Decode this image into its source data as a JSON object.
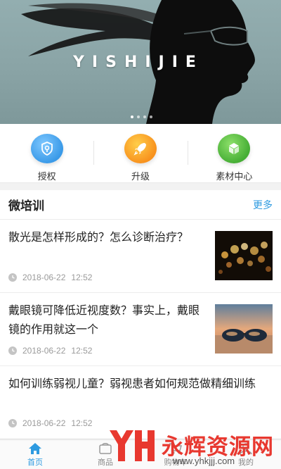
{
  "banner": {
    "text": "YISHIJIE",
    "slide_count": 4,
    "active_slide": 1
  },
  "quick_actions": [
    {
      "label": "授权",
      "icon": "shield-key-icon",
      "color": "#3a9ae8"
    },
    {
      "label": "升级",
      "icon": "rocket-icon",
      "color": "#f8921e"
    },
    {
      "label": "素材中心",
      "icon": "cube-icon",
      "color": "#46ae35"
    }
  ],
  "section": {
    "title": "微培训",
    "more": "更多",
    "articles": [
      {
        "title": "散光是怎样形成的？怎么诊断治疗？",
        "date": "2018-06-22",
        "time": "12:52",
        "thumb": "bokeh-lights-image"
      },
      {
        "title": "戴眼镜可降低近视度数？事实上，戴眼镜的作用就这一个",
        "date": "2018-06-22",
        "time": "12:52",
        "thumb": "sunglasses-beach-image"
      },
      {
        "title": "如何训练弱视儿童？弱视患者如何规范做精细训练",
        "date": "2018-06-22",
        "time": "12:52"
      }
    ]
  },
  "tabbar": [
    {
      "label": "首页",
      "icon": "home-icon",
      "active": true
    },
    {
      "label": "商品",
      "icon": "goods-icon",
      "active": false
    },
    {
      "label": "购物车",
      "icon": "cart-icon",
      "active": false
    },
    {
      "label": "我的",
      "icon": "user-icon",
      "active": false
    }
  ],
  "watermark": {
    "text": "永辉资源网",
    "url": "www.yhkjjj.com"
  },
  "colors": {
    "accent": "#2d9ae0",
    "watermark": "#e8382f"
  }
}
